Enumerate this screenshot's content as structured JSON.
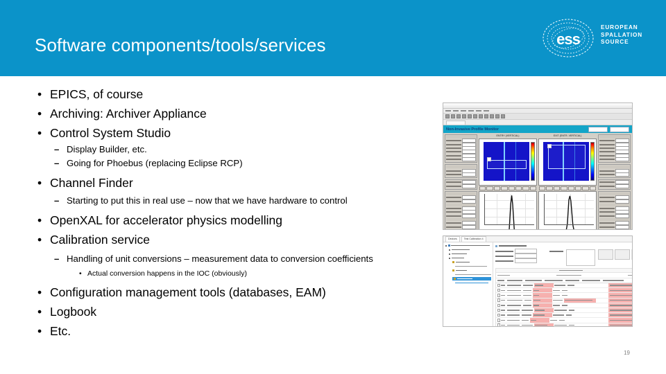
{
  "slide": {
    "title": "Software components/tools/services",
    "page_number": "19",
    "accent_color": "#0b93c9",
    "banner_color": "#13a5c8"
  },
  "logo": {
    "mark": "ess-logo-icon",
    "wordmark_line1": "EUROPEAN",
    "wordmark_line2": "SPALLATION",
    "wordmark_line3": "SOURCE"
  },
  "bullets": [
    {
      "level": 1,
      "marker": "•",
      "text": "EPICS, of course"
    },
    {
      "level": 1,
      "marker": "•",
      "text": "Archiving: Archiver Appliance"
    },
    {
      "level": 1,
      "marker": "•",
      "text": "Control System Studio"
    },
    {
      "level": 2,
      "marker": "–",
      "text": "Display Builder, etc."
    },
    {
      "level": 2,
      "marker": "–",
      "text": "Going for Phoebus (replacing Eclipse RCP)"
    },
    {
      "level": 1,
      "marker": "•",
      "text": "Channel Finder"
    },
    {
      "level": 2,
      "marker": "–",
      "text": "Starting to put this in real use – now that we have hardware to control"
    },
    {
      "level": 1,
      "marker": "•",
      "text": "OpenXAL for accelerator physics modelling"
    },
    {
      "level": 1,
      "marker": "•",
      "text": "Calibration service"
    },
    {
      "level": 2,
      "marker": "–",
      "text": "Handling of unit conversions – measurement data to conversion coefficients"
    },
    {
      "level": 3,
      "marker": "•",
      "text": "Actual conversion happens in the IOC (obviously)"
    },
    {
      "level": 1,
      "marker": "•",
      "text": "Configuration management tools (databases, EAM)"
    },
    {
      "level": 1,
      "marker": "•",
      "text": "Logbook"
    },
    {
      "level": 1,
      "marker": "•",
      "text": "Etc."
    }
  ],
  "screenshots": [
    {
      "name": "profile-monitor-application",
      "banner_title": "Non-Invasive Profile Monitor",
      "left_plot_title": "ENTRY (VERTICAL)",
      "right_plot_title": "EXIT (ENTR. VERTICAL)",
      "heatmap_background": "#1414c8",
      "colorbar": "jet"
    },
    {
      "name": "calibration-table-application",
      "tab_labels": [
        "Devices",
        "Test Calibration 4"
      ],
      "highlight_color": "#f6b0ae",
      "table_row_count": 10
    }
  ]
}
